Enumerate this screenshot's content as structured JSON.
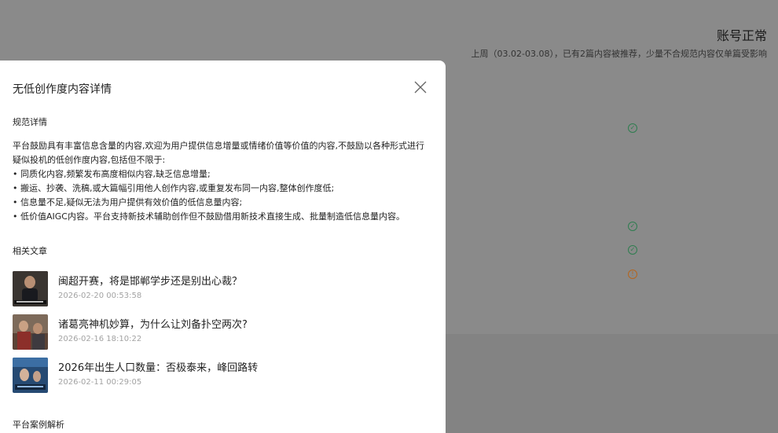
{
  "background": {
    "account_status": "账号正常",
    "status_detail": "上周（03.02-03.08），已有2篇内容被推荐，少量不合规范内容仅单篇受影响"
  },
  "drawer": {
    "title": "无低创作度内容详情",
    "close_icon": "close-icon",
    "rules_label": "规范详情",
    "rules_intro": "平台鼓励具有丰富信息含量的内容,欢迎为用户提供信息增量或情绪价值等价值的内容,不鼓励以各种形式进行疑似投机的低创作度内容,包括但不限于:",
    "rules_items": [
      "• 同质化内容,频繁发布高度相似内容,缺乏信息增量;",
      "• 搬运、抄袭、洗稿,或大篇幅引用他人创作内容,或重复发布同一内容,整体创作度低;",
      "• 信息量不足,疑似无法为用户提供有效价值的低信息量内容;",
      "• 低价值AIGC内容。平台支持新技术辅助创作但不鼓励借用新技术直接生成、批量制造低信息量内容。"
    ],
    "articles_label": "相关文章",
    "articles": [
      {
        "title": "闽超开赛，将是邯郸学步还是别出心裁？",
        "time": "2026-02-20 00:53:58"
      },
      {
        "title": "诸葛亮神机妙算，为什么让刘备扑空两次?",
        "time": "2026-02-16 18:10:22"
      },
      {
        "title": "2026年出生人口数量：否极泰来，峰回路转",
        "time": "2026-02-11 00:29:05"
      }
    ],
    "cases_label": "平台案例解析"
  }
}
